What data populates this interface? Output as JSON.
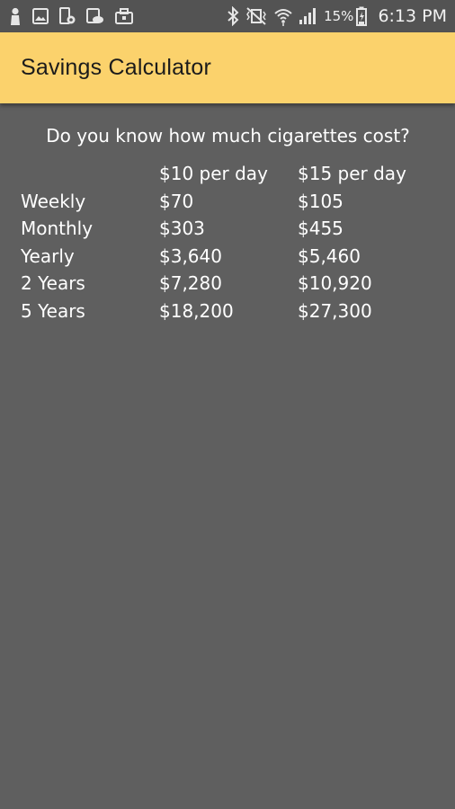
{
  "status_bar": {
    "battery_percent": "15%",
    "time": "6:13 PM",
    "icons": [
      "person-icon",
      "gallery-icon",
      "device-admin-icon",
      "cloud-sync-icon",
      "briefcase-icon",
      "bluetooth-icon",
      "vibrate-mute-icon",
      "wifi-icon",
      "signal-icon",
      "battery-icon"
    ]
  },
  "app_bar": {
    "title": "Savings Calculator",
    "color": "#fbd26c"
  },
  "main": {
    "question": "Do you know how much cigarettes cost?",
    "table": {
      "headers": [
        "",
        "$10 per day",
        "$15 per day"
      ],
      "rows": [
        {
          "label": "Weekly",
          "a": "$70",
          "b": "$105"
        },
        {
          "label": "Monthly",
          "a": "$303",
          "b": "$455"
        },
        {
          "label": "Yearly",
          "a": "$3,640",
          "b": "$5,460"
        },
        {
          "label": "2 Years",
          "a": "$7,280",
          "b": "$10,920"
        },
        {
          "label": "5 Years",
          "a": "$18,200",
          "b": "$27,300"
        }
      ]
    }
  }
}
